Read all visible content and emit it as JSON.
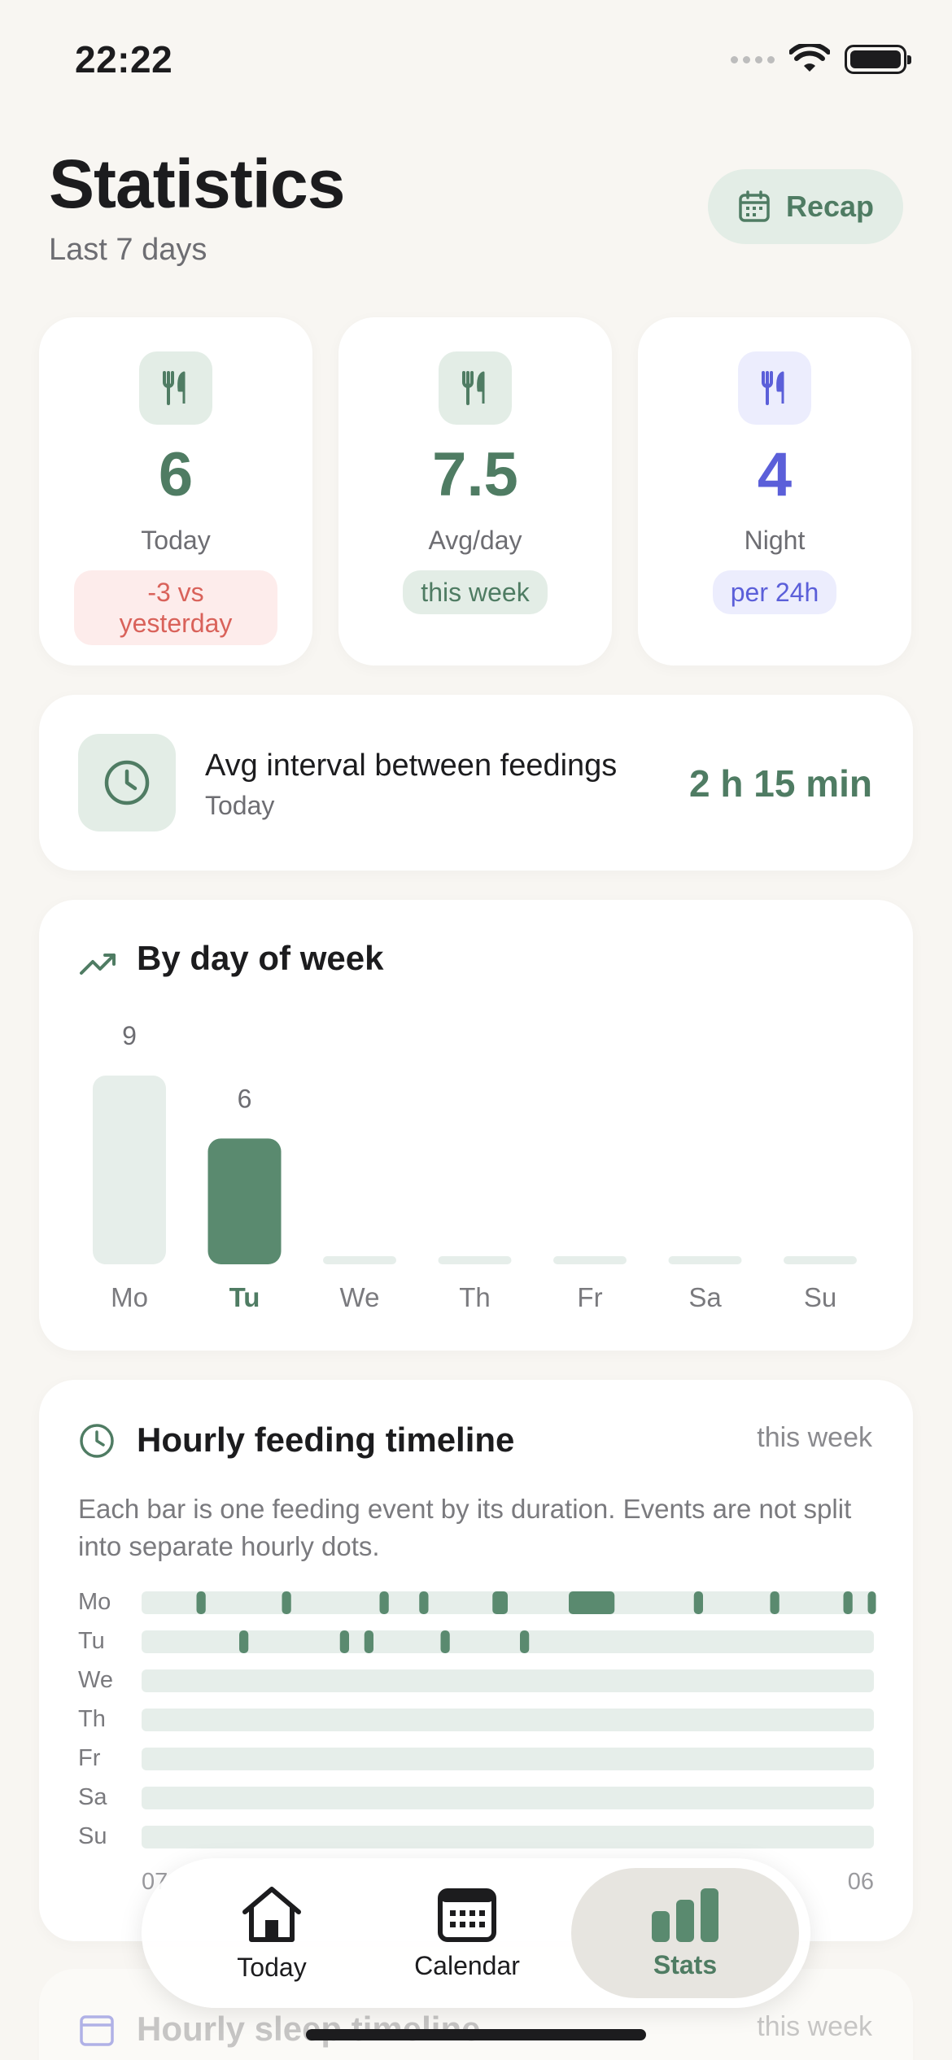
{
  "status_bar": {
    "time": "22:22"
  },
  "header": {
    "title": "Statistics",
    "subtitle": "Last 7 days",
    "recap_label": "Recap"
  },
  "stats": [
    {
      "value": "6",
      "label": "Today",
      "badge": "-3 vs yesterday",
      "color": "#4f7c63",
      "icon_bg": "#e3ede6",
      "badge_bg": "#fdeceb",
      "badge_color": "#d9625a",
      "icon": "fork-knife-icon"
    },
    {
      "value": "7.5",
      "label": "Avg/day",
      "badge": "this week",
      "color": "#4f7c63",
      "icon_bg": "#e3ede6",
      "badge_bg": "#e3ede6",
      "badge_color": "#4f7c63",
      "icon": "fork-knife-icon"
    },
    {
      "value": "4",
      "label": "Night",
      "badge": "per 24h",
      "color": "#5b5fd9",
      "icon_bg": "#ecedfd",
      "badge_bg": "#ecedfd",
      "badge_color": "#5b5fd9",
      "icon": "fork-knife-icon"
    }
  ],
  "interval": {
    "title": "Avg interval between feedings",
    "subtitle": "Today",
    "value": "2 h 15 min"
  },
  "week_chart": {
    "title": "By day of week",
    "icon": "trend-up-icon"
  },
  "chart_data": {
    "type": "bar",
    "categories": [
      "Mo",
      "Tu",
      "We",
      "Th",
      "Fr",
      "Sa",
      "Su"
    ],
    "values": [
      9,
      6,
      0,
      0,
      0,
      0,
      0
    ],
    "value_labels": [
      "9",
      "6",
      "",
      "",
      "",
      "",
      ""
    ],
    "highlight_index": 1,
    "ylim": [
      0,
      9
    ],
    "colors": {
      "base": "#e6eeea",
      "highlight": "#5a8a6f",
      "highlight_label": "#4f7c63",
      "label": "#7a7a7e"
    }
  },
  "timeline": {
    "title": "Hourly feeding timeline",
    "tag": "this week",
    "description": "Each bar is one feeding event by its duration. Events are not split into separate hourly dots.",
    "days": [
      "Mo",
      "Tu",
      "We",
      "Th",
      "Fr",
      "Sa",
      "Su"
    ],
    "hour_span": [
      6,
      30
    ],
    "events": [
      [
        [
          7.8,
          8.1
        ],
        [
          10.6,
          10.9
        ],
        [
          13.8,
          14.1
        ],
        [
          15.1,
          15.4
        ],
        [
          17.5,
          18.0
        ],
        [
          20.0,
          21.5
        ],
        [
          24.1,
          24.4
        ],
        [
          26.6,
          26.9
        ],
        [
          29.0,
          29.3
        ],
        [
          29.8,
          30.0
        ]
      ],
      [
        [
          9.2,
          9.5
        ],
        [
          12.5,
          12.8
        ],
        [
          13.3,
          13.6
        ],
        [
          15.8,
          16.1
        ],
        [
          18.4,
          18.7
        ]
      ],
      [],
      [],
      [],
      [],
      []
    ],
    "axis_labels": [
      "07",
      "06"
    ]
  },
  "sleep_section": {
    "title": "Hourly sleep timeline",
    "tag": "this week"
  },
  "tabbar": {
    "items": [
      {
        "label": "Today",
        "icon": "house-icon"
      },
      {
        "label": "Calendar",
        "icon": "calendar-icon"
      },
      {
        "label": "Stats",
        "icon": "bar-chart-icon"
      }
    ],
    "active_index": 2
  }
}
